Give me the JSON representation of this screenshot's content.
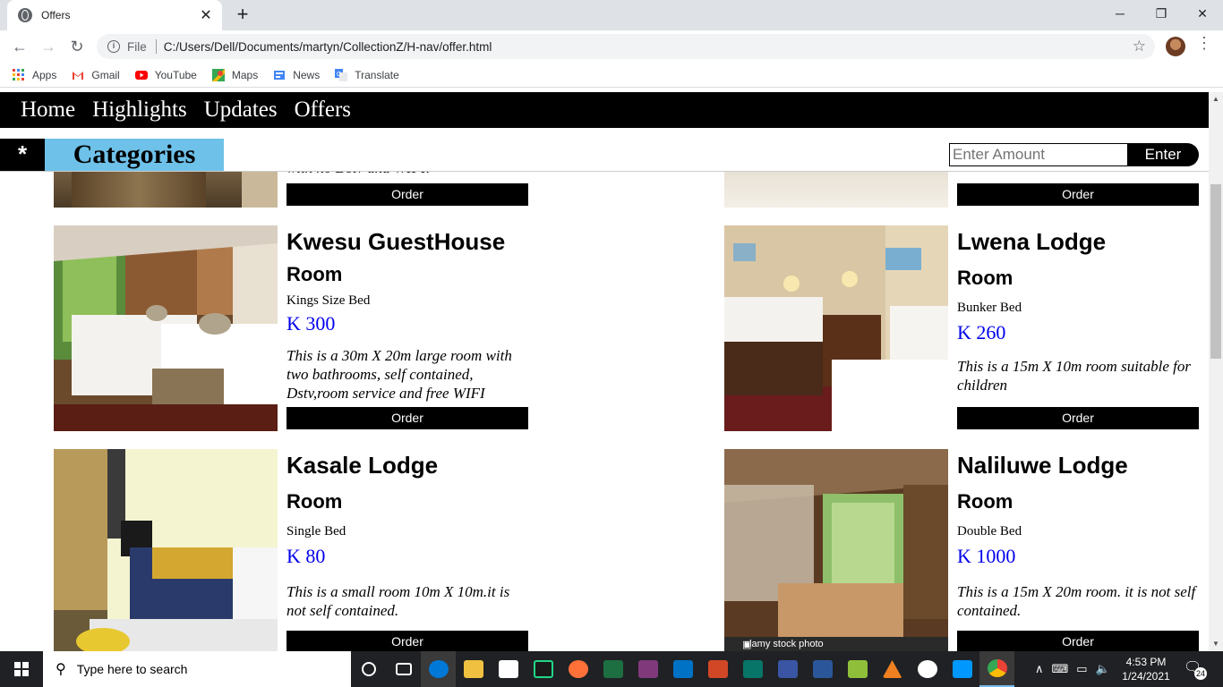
{
  "browser": {
    "tab_title": "Offers",
    "file_label": "File",
    "url": "C:/Users/Dell/Documents/martyn/CollectionZ/H-nav/offer.html",
    "bookmarks": [
      {
        "label": "Apps",
        "icon": "apps-grid-icon",
        "color": "#ea4335"
      },
      {
        "label": "Gmail",
        "icon": "gmail-icon",
        "color": "#ea4335"
      },
      {
        "label": "YouTube",
        "icon": "youtube-icon",
        "color": "#ff0000"
      },
      {
        "label": "Maps",
        "icon": "maps-icon",
        "color": "#34a853"
      },
      {
        "label": "News",
        "icon": "news-icon",
        "color": "#4285f4"
      },
      {
        "label": "Translate",
        "icon": "translate-icon",
        "color": "#4285f4"
      }
    ]
  },
  "site": {
    "nav": [
      "Home",
      "Highlights",
      "Updates",
      "Offers"
    ],
    "star": "*",
    "categories_label": "Categories",
    "amount_placeholder": "Enter Amount",
    "enter_label": "Enter",
    "partial_top_text": "with no Dstv and WIFI.",
    "order_label": "Order",
    "offers": [
      {
        "name": "Kwesu GuestHouse",
        "room": "Room",
        "bed": "Kings Size Bed",
        "price": "K 300",
        "desc": "This is a 30m X 20m large room with two bathrooms, self contained, Dstv,room service and free WIFI"
      },
      {
        "name": "Lwena Lodge",
        "room": "Room",
        "bed": "Bunker Bed",
        "price": "K 260",
        "desc": "This is a 15m X 10m room suitable for children"
      },
      {
        "name": "Kasale Lodge",
        "room": "Room",
        "bed": "Single Bed",
        "price": "K 80",
        "desc": "This is a small room 10m X 10m.it is not self contained."
      },
      {
        "name": "Naliluwe Lodge",
        "room": "Room",
        "bed": "Double Bed",
        "price": "K 1000",
        "desc": "This is a 15m X 20m room. it is not self contained."
      }
    ],
    "watermark": "alamy stock photo"
  },
  "taskbar": {
    "search_placeholder": "Type here to search",
    "time": "4:53 PM",
    "date": "1/24/2021",
    "notification_count": "24"
  }
}
